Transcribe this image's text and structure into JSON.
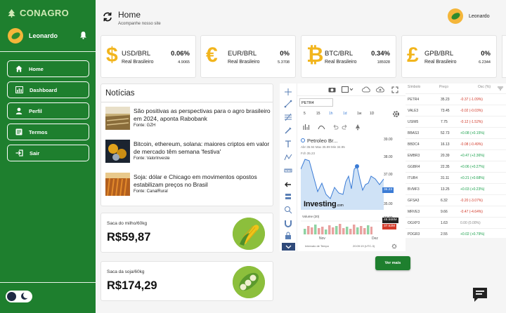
{
  "brand": {
    "name": "CONAGRO"
  },
  "sidebar": {
    "user_name": "Leonardo",
    "items": [
      {
        "label": "Home"
      },
      {
        "label": "Dashboard"
      },
      {
        "label": "Perfil"
      },
      {
        "label": "Termos"
      },
      {
        "label": "Sair"
      }
    ]
  },
  "header": {
    "title": "Home",
    "subtitle": "Acompanhe nosso site",
    "user_name": "Leonardo"
  },
  "currencies": [
    {
      "symbol": "$",
      "pair": "USD/BRL",
      "name": "Real Brasileiro",
      "pct": "0.06%",
      "value": "4.9065"
    },
    {
      "symbol": "€",
      "pair": "EUR/BRL",
      "name": "Real Brasileiro",
      "pct": "0%",
      "value": "5.3708"
    },
    {
      "symbol": "₿",
      "pair": "BTC/BRL",
      "name": "Real Brasileiro",
      "pct": "0.34%",
      "value": "185928"
    },
    {
      "symbol": "£",
      "pair": "GPB/BRL",
      "name": "Real Brasileiro",
      "pct": "0%",
      "value": "6.2344"
    }
  ],
  "news": {
    "title": "Notícias",
    "items": [
      {
        "title": "São positivas as perspectivas para o agro brasileiro em 2024, aponta Rabobank",
        "source": "Fonte: GZH"
      },
      {
        "title": "Bitcoin, ethereum, solana: maiores criptos em valor de mercado têm semana 'festiva'",
        "source": "Fonte: ValorInveste"
      },
      {
        "title": "Soja: dólar e Chicago em movimentos opostos estabilizam preços no Brasil",
        "source": "Fonte: CanalRural"
      }
    ]
  },
  "saca_milho": {
    "label": "Saca do milho/60kg",
    "price": "R$59,87"
  },
  "saca_soja": {
    "label": "Saca da soja/60kg",
    "price": "R$174,29"
  },
  "chart": {
    "ticker": "PETR4",
    "timeframes": [
      "5",
      "15",
      "1h",
      "1d",
      "1w",
      "1D"
    ],
    "title": "Petroleo Br...",
    "ohlc": "Abr 35.94 Max 35.99 Min 34.95",
    "fdh": "Fch 35.23",
    "y_ticks": [
      "39.00",
      "38.00",
      "37.00",
      "36.23",
      "35.00",
      "34.00",
      "48.568M",
      "37.52M"
    ],
    "last_price": "36.23",
    "volume_label": "Volume (20)",
    "x_labels": [
      "Nov",
      "Dez"
    ],
    "footer_left": "Intervalo de Tempo",
    "footer_time": "20:09:19 (UTC-3)",
    "logo": "Investing",
    "logo_suffix": ".com"
  },
  "table": {
    "headers": [
      "Símbolo",
      "Preço",
      "Osc (%)"
    ],
    "rows": [
      {
        "sym": "PETR4",
        "price": "35.23",
        "chg": "-0.37 (-1.09%)",
        "dir": "neg"
      },
      {
        "sym": "VALE3",
        "price": "73.45",
        "chg": "-0.02 (-0.03%)",
        "dir": "neg"
      },
      {
        "sym": "USIM5",
        "price": "7.75",
        "chg": "-0.12 (-1.52%)",
        "dir": "neg"
      },
      {
        "sym": "BBAS3",
        "price": "52.73",
        "chg": "+0.08 (+0.15%)",
        "dir": "pos"
      },
      {
        "sym": "BBDC4",
        "price": "16.13",
        "chg": "-0.08 (-0.49%)",
        "dir": "neg"
      },
      {
        "sym": "EMBR3",
        "price": "20.39",
        "chg": "+0.47 (+2.36%)",
        "dir": "pos"
      },
      {
        "sym": "GGBR4",
        "price": "22.35",
        "chg": "+0.06 (+0.27%)",
        "dir": "pos"
      },
      {
        "sym": "ITUB4",
        "price": "31.11",
        "chg": "+0.21 (+0.68%)",
        "dir": "pos"
      },
      {
        "sym": "BVMF3",
        "price": "13.25",
        "chg": "+0.03 (+0.23%)",
        "dir": "pos"
      },
      {
        "sym": "GFSA3",
        "price": "6.32",
        "chg": "-0.20 (-3.07%)",
        "dir": "neg"
      },
      {
        "sym": "MRVE3",
        "price": "9.66",
        "chg": "-0.47 (-4.64%)",
        "dir": "neg"
      },
      {
        "sym": "OGXP3",
        "price": "1.63",
        "chg": "0.00 (0.00%)",
        "dir": "neu"
      },
      {
        "sym": "PDGR3",
        "price": "2.55",
        "chg": "+0.02 (+0.79%)",
        "dir": "pos"
      }
    ],
    "more_label": "Ver mais"
  }
}
